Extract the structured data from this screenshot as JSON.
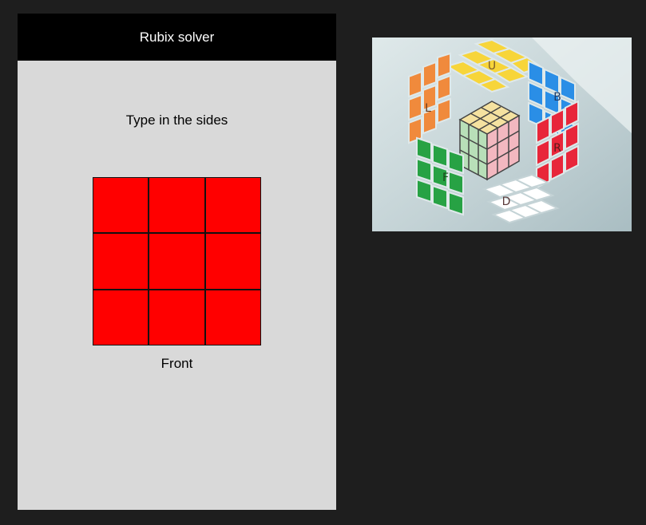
{
  "app": {
    "title": "Rubix solver",
    "instruction": "Type in the sides",
    "face_label": "Front"
  },
  "face_grid": {
    "cells": [
      "#ff0000",
      "#ff0000",
      "#ff0000",
      "#ff0000",
      "#ff0000",
      "#ff0000",
      "#ff0000",
      "#ff0000",
      "#ff0000"
    ]
  },
  "reference_image": {
    "face_letters": {
      "up": "U",
      "left": "L",
      "back": "B",
      "front": "F",
      "right": "R",
      "down": "D"
    }
  },
  "colors": {
    "app_bar": "#000000",
    "screen_bg": "#d9d9d9",
    "canvas_bg": "#1e1e1e"
  }
}
